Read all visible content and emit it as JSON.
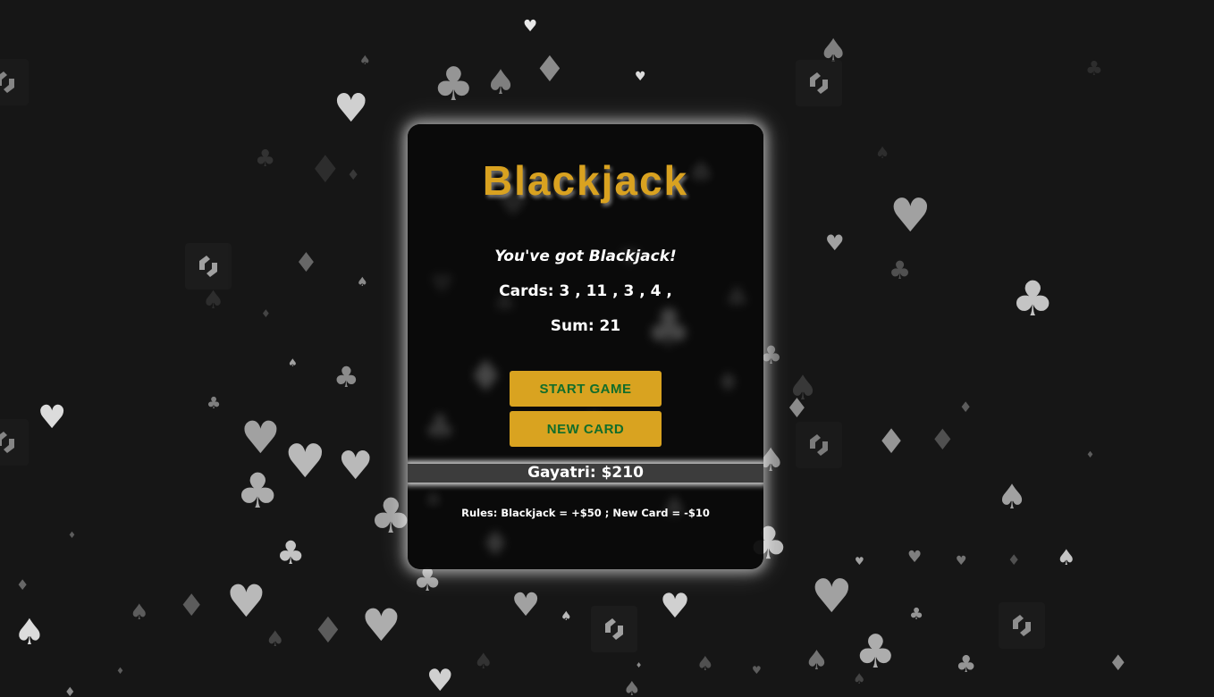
{
  "game": {
    "title": "Blackjack",
    "message": "You've got Blackjack!",
    "cards_label": "Cards:",
    "cards": [
      3,
      11,
      3,
      4
    ],
    "sum_label": "Sum:",
    "sum": 21
  },
  "buttons": {
    "start_game": "START GAME",
    "new_card": "NEW CARD"
  },
  "player": {
    "name": "Gayatri",
    "chips": "$210"
  },
  "rules": "Rules: Blackjack = +$50 ; New Card = -$10",
  "colors": {
    "background": "#161616",
    "title_gold": "#d9a220",
    "button_gold": "#d9a320",
    "button_text_green": "#116d2a",
    "player_bar": "#3c3c3c",
    "text": "#ffffff"
  },
  "background_icons": [
    "heart-icon",
    "diamond-icon",
    "club-icon",
    "spade-icon",
    "logo-mark-icon"
  ]
}
